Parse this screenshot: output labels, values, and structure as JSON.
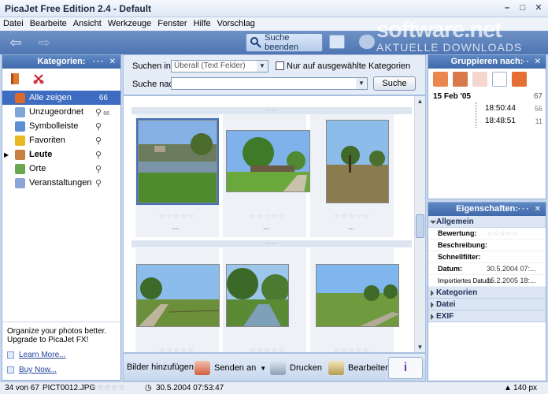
{
  "window": {
    "title": "PicaJet Free Edition 2.4  - Default"
  },
  "menu": [
    "Datei",
    "Bearbeite",
    "Ansicht",
    "Werkzeuge",
    "Fenster",
    "Hilfe",
    "Vorschlag"
  ],
  "toolbar": {
    "search_end_label": "Suche beenden"
  },
  "watermark": {
    "line1": "software.net",
    "line2": "AKTUELLE DOWNLOADS"
  },
  "categories": {
    "title": "Kategorien:",
    "items": [
      {
        "label": "Alle zeigen",
        "count": "66",
        "selected": true,
        "icon_color": "#d96a2a",
        "bold": false
      },
      {
        "label": "Unzugeordnet",
        "count": "66",
        "selected": false,
        "icon_color": "#7ea7d8",
        "bold": false
      },
      {
        "label": "Symbolleiste",
        "count": "",
        "selected": false,
        "icon_color": "#5a8fd4",
        "bold": false
      },
      {
        "label": "Favoriten",
        "count": "",
        "selected": false,
        "icon_color": "#e8b820",
        "bold": false
      },
      {
        "label": "Leute",
        "count": "",
        "selected": false,
        "icon_color": "#c88040",
        "bold": true
      },
      {
        "label": "Orte",
        "count": "",
        "selected": false,
        "icon_color": "#6aa84f",
        "bold": false
      },
      {
        "label": "Veranstaltungen",
        "count": "",
        "selected": false,
        "icon_color": "#8aa6d6",
        "bold": false
      }
    ],
    "promo_line1": "Organize your photos better.",
    "promo_line2": "Upgrade to PicaJet FX!",
    "learn_more": "Learn More...",
    "buy_now": "Buy Now..."
  },
  "search": {
    "search_in_label": "Suchen in:",
    "search_in_value": "Überall (Text Felder)",
    "only_selected_label": "Nur auf ausgewählte Kategorien",
    "search_for_label": "Suche nach",
    "search_for_value": "",
    "search_button": "Suche"
  },
  "photos": {
    "more": "...",
    "rating": "☆☆☆☆☆"
  },
  "actions": {
    "add_images": "Bilder hinzufügen",
    "send": "Senden an",
    "print": "Drucken",
    "edit": "Bearbeiten"
  },
  "grouping": {
    "title": "Gruppieren nach:",
    "year_count": "67",
    "date_label": "15 Feb  '05",
    "date_count": "",
    "times": [
      {
        "time": "18:50:44",
        "count": "56"
      },
      {
        "time": "18:48:51",
        "count": "11"
      }
    ]
  },
  "properties": {
    "title": "Eigenschaften:",
    "general_section": "Allgemein",
    "rows": [
      {
        "key": "Bewertung:",
        "value": "☆☆☆☆☆"
      },
      {
        "key": "Beschreibung:",
        "value": ""
      },
      {
        "key": "Schnellfilter:",
        "value": ""
      },
      {
        "key": "Datum:",
        "value": "30.5.2004 07:..."
      },
      {
        "key": "Importiertes Datum:",
        "value": "15.2.2005 18:..."
      }
    ],
    "collapsed_sections": [
      "Kategorien",
      "Datei",
      "EXIF"
    ]
  },
  "status": {
    "position": "34 von 67",
    "filename": "PICT0012.JPG",
    "rating": "☆☆☆☆☆",
    "datetime": "30.5.2004 07:53:47",
    "zoom": "140 px"
  }
}
